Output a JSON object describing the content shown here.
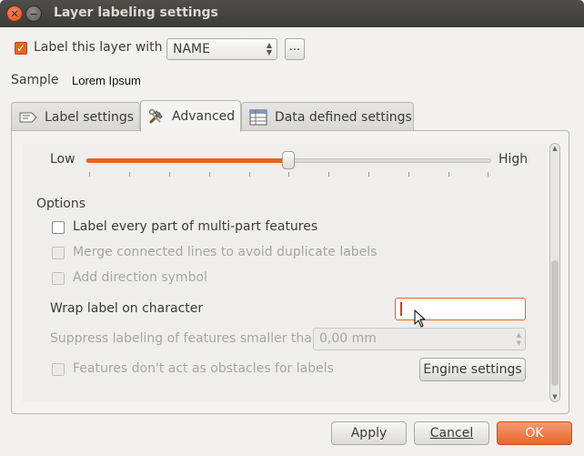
{
  "window": {
    "title": "Layer labeling settings"
  },
  "top": {
    "label_checkbox_text": "Label this layer with",
    "field_value": "NAME",
    "expression_button": "...",
    "sample_label": "Sample",
    "sample_text": "Lorem Ipsum"
  },
  "tabs": [
    {
      "label": "Label settings"
    },
    {
      "label": "Advanced"
    },
    {
      "label": "Data defined settings"
    }
  ],
  "advanced": {
    "priority_low": "Low",
    "priority_high": "High",
    "priority_level": 0.5,
    "options_heading": "Options",
    "opt_multipart": "Label every part of multi-part features",
    "opt_merge": "Merge connected lines to avoid duplicate labels",
    "opt_direction": "Add direction symbol",
    "wrap_label": "Wrap label on character",
    "wrap_value": "",
    "suppress_label": "Suppress labeling of features smaller than",
    "suppress_value": "0,00 mm",
    "obstacles_label": "Features don't act as obstacles for labels",
    "engine_button": "Engine settings"
  },
  "footer": {
    "apply": "Apply",
    "cancel": "Cancel",
    "ok": "OK"
  },
  "colors": {
    "accent": "#e9641f",
    "titlebar": "#3c3b37"
  }
}
